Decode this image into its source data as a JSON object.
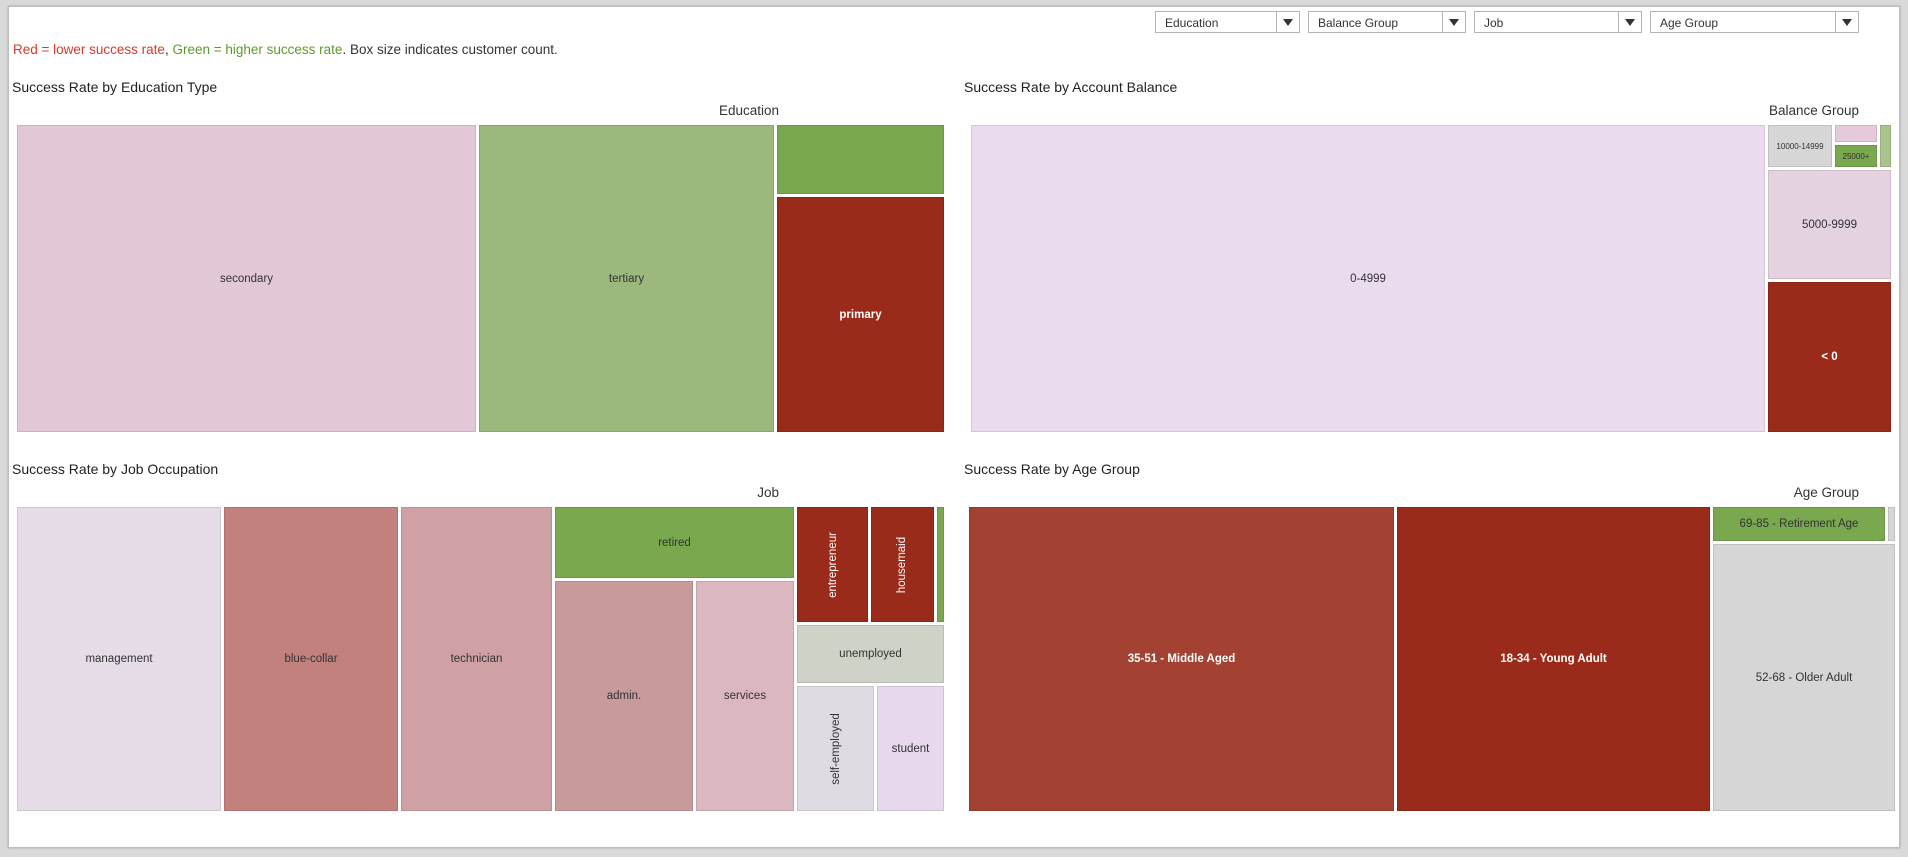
{
  "filters": [
    {
      "label": "Education"
    },
    {
      "label": "Balance Group"
    },
    {
      "label": "Job"
    },
    {
      "label": "Age Group"
    }
  ],
  "legend": {
    "red_text": "Red = lower success rate",
    "separator": ", ",
    "green_text": "Green = higher success rate",
    "rest": ". Box size indicates customer count."
  },
  "colors": {
    "low_success": "#9a2a1a",
    "high_success": "#79a84e",
    "neutral": "#e2dde6"
  },
  "panels": {
    "education": {
      "title": "Success Rate by Education Type",
      "dimension": "Education",
      "tiles": [
        {
          "label": "secondary",
          "color": "#e2c8d6"
        },
        {
          "label": "tertiary",
          "color": "#9cb87c"
        },
        {
          "label": "",
          "color": "#79a84e"
        },
        {
          "label": "primary",
          "color": "#9a2a1a"
        }
      ]
    },
    "balance": {
      "title": "Success Rate by Account Balance",
      "dimension": "Balance Group",
      "tiles": [
        {
          "label": "0-4999",
          "color": "#eadcee"
        },
        {
          "label": "10000-14999",
          "color": "#d7d6d6"
        },
        {
          "label": "",
          "color": "#e7c9dc"
        },
        {
          "label": "25000+",
          "color": "#79a84e"
        },
        {
          "label": "",
          "color": "#a9c28e"
        },
        {
          "label": "5000-9999",
          "color": "#e5d2e0"
        },
        {
          "label": "< 0",
          "color": "#9a2a1a"
        }
      ]
    },
    "job": {
      "title": "Success Rate by Job Occupation",
      "dimension": "Job",
      "tiles": [
        {
          "label": "management",
          "color": "#e5dce8"
        },
        {
          "label": "blue-collar",
          "color": "#c2817d"
        },
        {
          "label": "technician",
          "color": "#cfa1a4"
        },
        {
          "label": "retired",
          "color": "#79a84e"
        },
        {
          "label": "admin.",
          "color": "#c99a9c"
        },
        {
          "label": "services",
          "color": "#dbb7c0"
        },
        {
          "label": "entrepreneur",
          "color": "#9a2a1a"
        },
        {
          "label": "housemaid",
          "color": "#9a2a1a"
        },
        {
          "label": "",
          "color": "#79a84e"
        },
        {
          "label": "unemployed",
          "color": "#cfd2c6"
        },
        {
          "label": "self-employed",
          "color": "#dedbe3"
        },
        {
          "label": "student",
          "color": "#e8d8ee"
        }
      ]
    },
    "age": {
      "title": "Success Rate by Age Group",
      "dimension": "Age Group",
      "tiles": [
        {
          "label": "35-51 - Middle Aged",
          "color": "#a34233"
        },
        {
          "label": "18-34 - Young Adult",
          "color": "#9a2a1a"
        },
        {
          "label": "69-85 - Retirement Age",
          "color": "#79a84e"
        },
        {
          "label": "",
          "color": "#d7d6d6"
        },
        {
          "label": "52-68 - Older Adult",
          "color": "#d7d6d6"
        }
      ]
    }
  }
}
